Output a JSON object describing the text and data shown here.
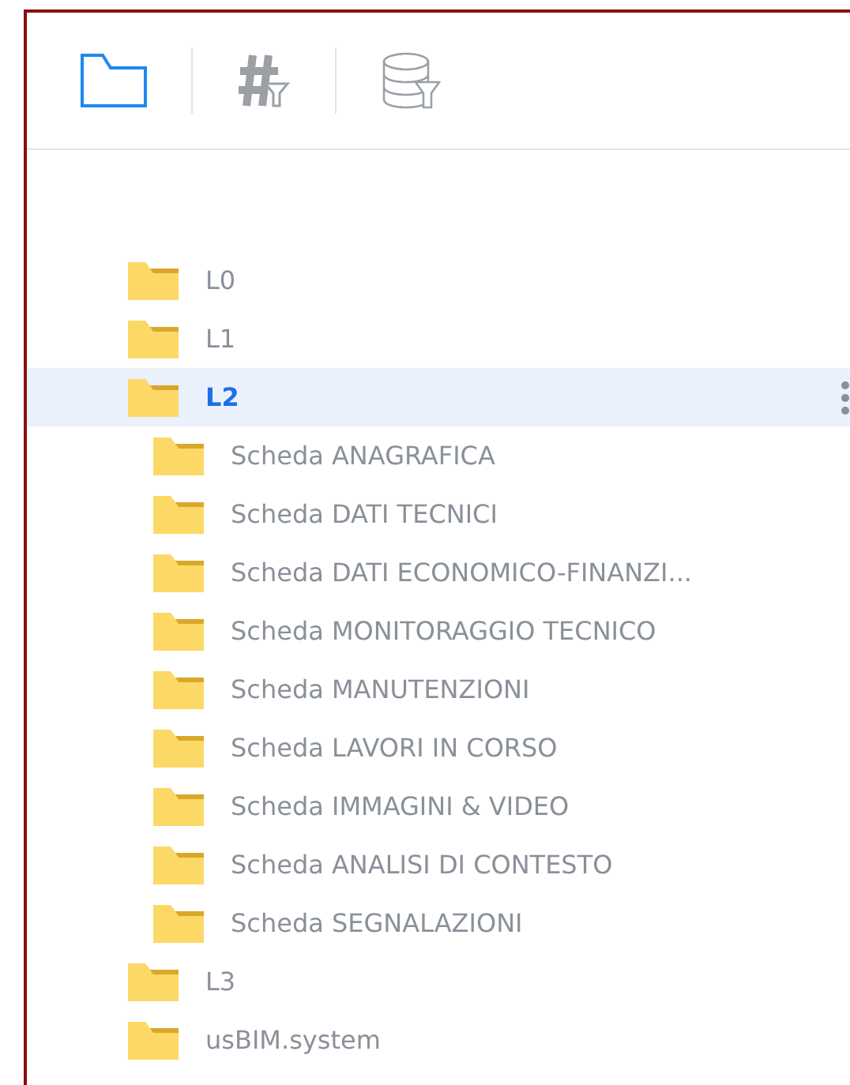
{
  "toolbar": {
    "tabs": [
      {
        "kind": "folder",
        "selected": true
      },
      {
        "kind": "hash-filter",
        "selected": false
      },
      {
        "kind": "database-filter",
        "selected": false
      }
    ]
  },
  "tree": [
    {
      "label": "L0",
      "selected": false
    },
    {
      "label": "L1",
      "selected": false
    },
    {
      "label": "L2",
      "selected": true,
      "children": [
        {
          "label": "Scheda ANAGRAFICA",
          "selected": false
        },
        {
          "label": "Scheda DATI TECNICI",
          "selected": false
        },
        {
          "label": "Scheda DATI ECONOMICO-FINANZI...",
          "selected": false
        },
        {
          "label": "Scheda MONITORAGGIO TECNICO",
          "selected": false
        },
        {
          "label": "Scheda MANUTENZIONI",
          "selected": false
        },
        {
          "label": "Scheda LAVORI IN CORSO",
          "selected": false
        },
        {
          "label": "Scheda IMMAGINI & VIDEO",
          "selected": false
        },
        {
          "label": "Scheda ANALISI DI CONTESTO",
          "selected": false
        },
        {
          "label": "Scheda SEGNALAZIONI",
          "selected": false
        }
      ]
    },
    {
      "label": "L3",
      "selected": false
    },
    {
      "label": "usBIM.system",
      "selected": false
    }
  ]
}
